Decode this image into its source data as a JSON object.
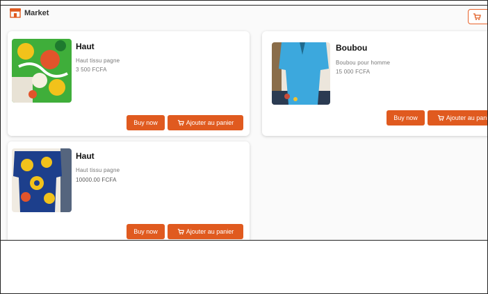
{
  "header": {
    "brand": "Market",
    "brand_icon": "storefront-icon",
    "cart_icon": "cart-icon",
    "accent_color": "#e05a1f"
  },
  "products": [
    {
      "title": "Haut",
      "description": "Haut tissu pagne",
      "price": "3 500 FCFA",
      "buy_label": "Buy now",
      "add_label": "Ajouter au panier"
    },
    {
      "title": "Boubou",
      "description": "Boubou pour homme",
      "price": "15 000 FCFA",
      "buy_label": "Buy now",
      "add_label": "Ajouter au panier"
    },
    {
      "title": "Haut",
      "description": "Haut tissu pagne",
      "price": "10000.00 FCFA",
      "buy_label": "Buy now",
      "add_label": "Ajouter au panier"
    }
  ]
}
